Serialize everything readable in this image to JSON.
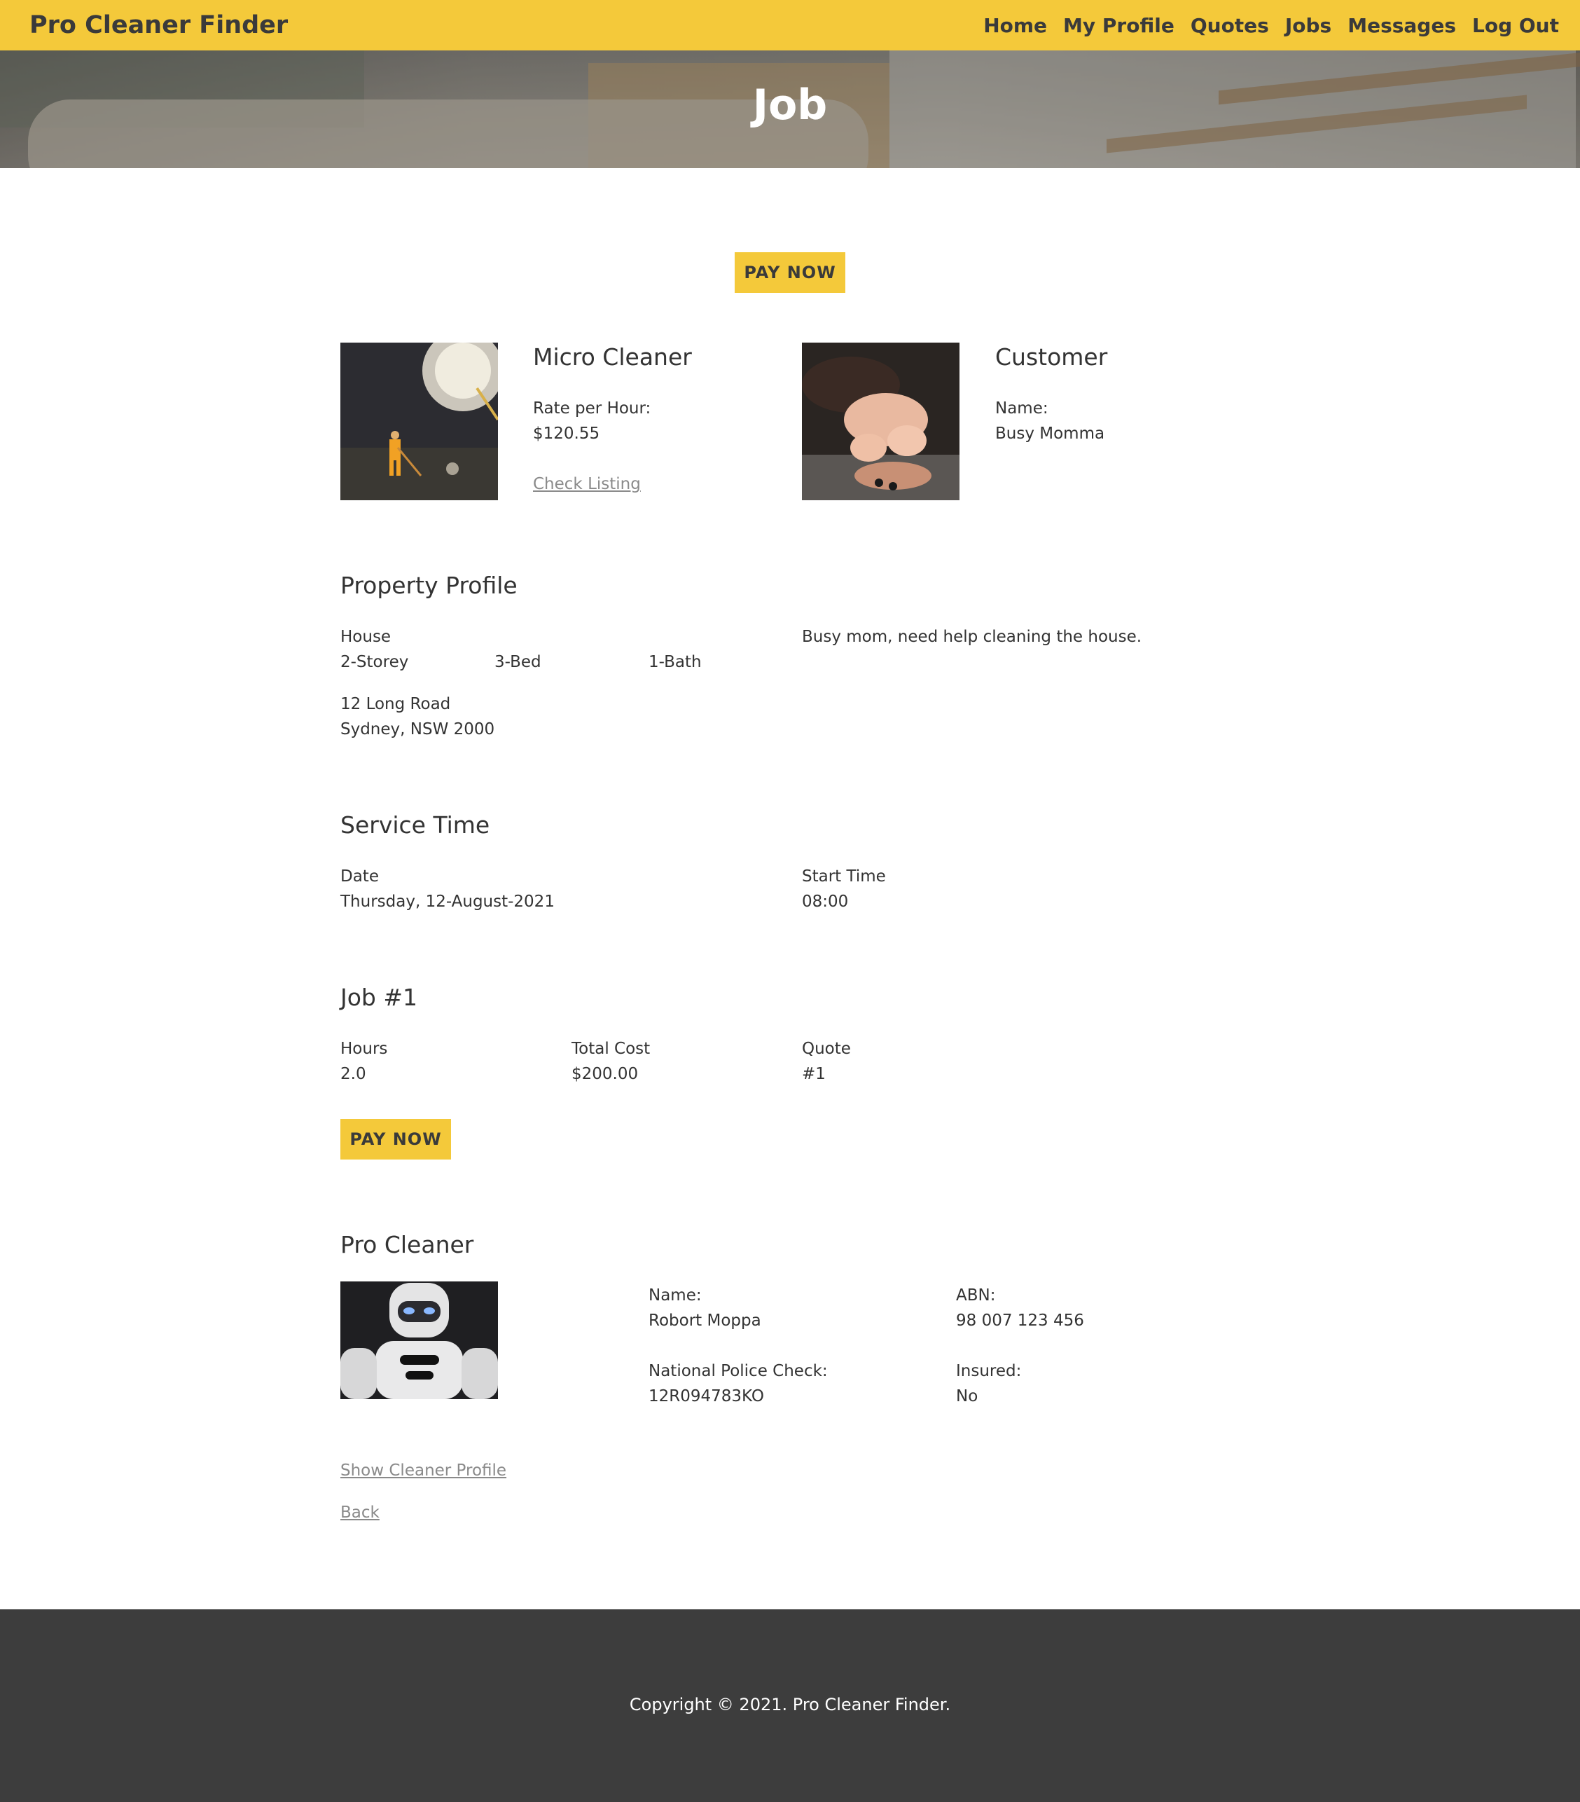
{
  "nav": {
    "brand": "Pro Cleaner Finder",
    "links": [
      "Home",
      "My Profile",
      "Quotes",
      "Jobs",
      "Messages",
      "Log Out"
    ]
  },
  "hero": {
    "title": "Job"
  },
  "pay_button_label": "PAY NOW",
  "cleaner_card": {
    "name": "Micro Cleaner",
    "rate_label": "Rate per Hour:",
    "rate_value": "$120.55",
    "check_link": "Check Listing"
  },
  "customer_card": {
    "title": "Customer",
    "name_label": "Name:",
    "name_value": "Busy Momma"
  },
  "property": {
    "title": "Property Profile",
    "type": "House",
    "storeys": "2-Storey",
    "beds": "3-Bed",
    "baths": "1-Bath",
    "address_line1": "12 Long Road",
    "address_line2": "Sydney, NSW 2000",
    "note": "Busy mom, need help cleaning the house."
  },
  "service_time": {
    "title": "Service Time",
    "date_label": "Date",
    "date_value": "Thursday, 12-August-2021",
    "start_label": "Start Time",
    "start_value": "08:00"
  },
  "job": {
    "title": "Job #1",
    "hours_label": "Hours",
    "hours_value": "2.0",
    "cost_label": "Total Cost",
    "cost_value": "$200.00",
    "quote_label": "Quote",
    "quote_value": "#1"
  },
  "pro_cleaner": {
    "title": "Pro Cleaner",
    "name_label": "Name:",
    "name_value": "Robort Moppa",
    "abn_label": "ABN:",
    "abn_value": "98 007 123 456",
    "police_label": "National Police Check:",
    "police_value": "12R094783KO",
    "insured_label": "Insured:",
    "insured_value": "No"
  },
  "links": {
    "show_profile": "Show Cleaner Profile",
    "back": "Back"
  },
  "footer": {
    "copyright": "Copyright © 2021. Pro Cleaner Finder."
  },
  "colors": {
    "accent": "#f4c93a",
    "footer_bg": "#3d3d3d",
    "text": "#333333",
    "link": "#8a8a8a"
  }
}
